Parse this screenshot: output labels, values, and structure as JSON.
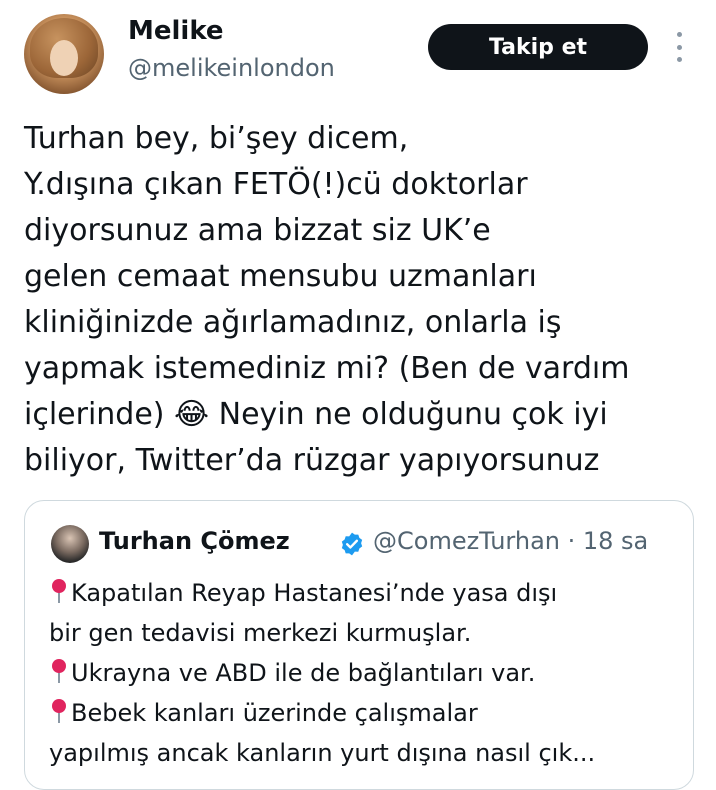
{
  "author": {
    "name": "Melike",
    "handle": "@melikeinlondon",
    "follow_label": "Takip et"
  },
  "tweet": {
    "lines": [
      "Turhan bey, bi’şey dicem,",
      "Y.dışına çıkan FETÖ(!)cü  doktorlar",
      "diyorsunuz ama bizzat siz UK’e",
      "gelen cemaat mensubu uzmanları",
      "kliniğinizde ağırlamadınız, onlarla iş",
      "yapmak istemediniz mi? (Ben de vardım",
      "içlerinde) 😂 Neyin ne olduğunu çok iyi",
      "biliyor, Twitter’da rüzgar yapıyorsunuz"
    ]
  },
  "quote": {
    "name": "Turhan Çömez",
    "handle_time": "@ComezTurhan · 18 sa",
    "icons": {
      "verified": "verified-badge-icon",
      "pin": "round-pushpin-icon"
    },
    "lines": [
      {
        "pin": true,
        "text": "Kapatılan Reyap Hastanesi’nde yasa dışı"
      },
      {
        "pin": false,
        "text": "bir gen tedavisi merkezi kurmuşlar."
      },
      {
        "pin": true,
        "text": "Ukrayna ve ABD ile de bağlantıları var."
      },
      {
        "pin": true,
        "text": "Bebek kanları üzerinde çalışmalar"
      },
      {
        "pin": false,
        "text": "yapılmış ancak kanların yurt dışına nasıl çık..."
      }
    ]
  },
  "colors": {
    "text": "#0f1419",
    "secondary": "#536471",
    "verified": "#1d9bf0",
    "pin": "#e0245e",
    "button_bg": "#0f1419"
  }
}
